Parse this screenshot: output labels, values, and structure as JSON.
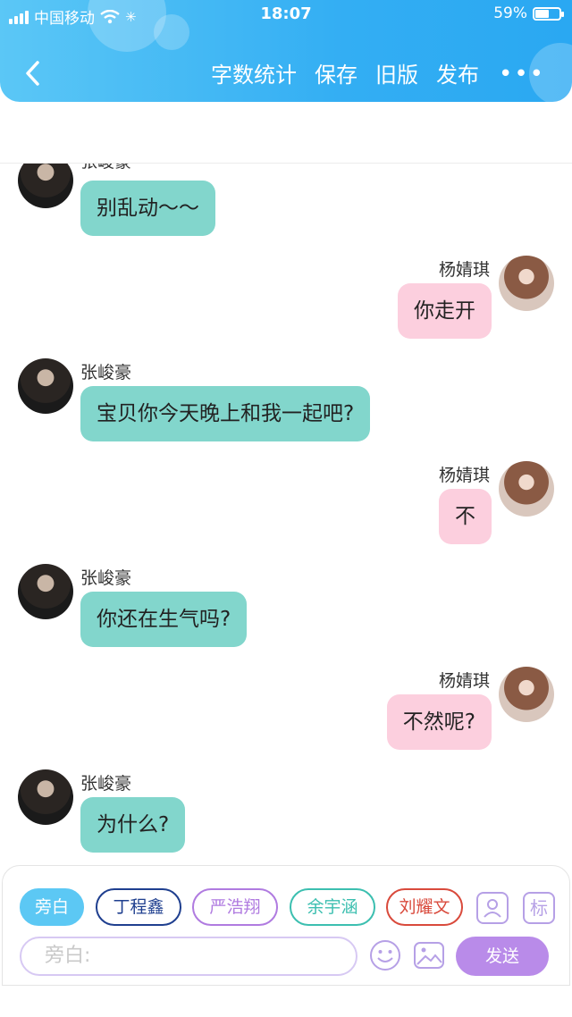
{
  "status_bar": {
    "carrier": "中国移动",
    "time": "18:07",
    "battery": "59%",
    "battery_level": 0.59
  },
  "navbar": {
    "back_icon": "chevron-left-icon",
    "actions": [
      "字数统计",
      "保存",
      "旧版",
      "发布"
    ],
    "more_icon": "more-horizontal-icon"
  },
  "messages": [
    {
      "side": "left",
      "speaker": "张峻豪",
      "text": "别乱动～～"
    },
    {
      "side": "right",
      "speaker": "杨婧琪",
      "text": "你走开"
    },
    {
      "side": "left",
      "speaker": "张峻豪",
      "text": "宝贝你今天晚上和我一起吧?"
    },
    {
      "side": "right",
      "speaker": "杨婧琪",
      "text": "不"
    },
    {
      "side": "left",
      "speaker": "张峻豪",
      "text": "你还在生气吗?"
    },
    {
      "side": "right",
      "speaker": "杨婧琪",
      "text": "不然呢?"
    },
    {
      "side": "left",
      "speaker": "张峻豪",
      "text": "为什么?"
    }
  ],
  "roles": [
    {
      "label": "旁白",
      "active": true,
      "color": "#5cc8f4"
    },
    {
      "label": "丁程鑫",
      "active": false,
      "color": "#1f3f8f"
    },
    {
      "label": "严浩翔",
      "active": false,
      "color": "#b07be0"
    },
    {
      "label": "余宇涵",
      "active": false,
      "color": "#3cbfb0"
    },
    {
      "label": "刘耀文",
      "active": false,
      "color": "#d94a3c"
    }
  ],
  "tools": {
    "person_icon": "person-card-icon",
    "tag_label": "标"
  },
  "composer": {
    "placeholder": "旁白:",
    "emoji_icon": "emoji-icon",
    "image_icon": "image-icon",
    "send_label": "发送"
  }
}
